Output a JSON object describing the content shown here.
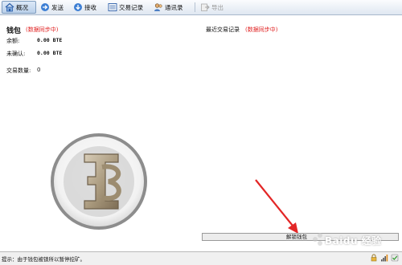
{
  "toolbar": {
    "items": [
      {
        "label": "概况",
        "icon": "home-icon",
        "active": true
      },
      {
        "label": "发送",
        "icon": "send-arrow-icon"
      },
      {
        "label": "接收",
        "icon": "receive-arrow-icon"
      },
      {
        "label": "交易记录",
        "icon": "transactions-list-icon"
      },
      {
        "label": "通讯录",
        "icon": "address-book-icon"
      },
      {
        "label": "导出",
        "icon": "export-icon",
        "disabled": true
      }
    ]
  },
  "wallet": {
    "title": "钱包",
    "sync_status": "(数据同步中)",
    "balance_label": "余额:",
    "balance_value": "0.00 BTE",
    "unconfirmed_label": "未确认:",
    "unconfirmed_value": "0.00 BTE",
    "tx_count_label": "交易数量:",
    "tx_count_value": "0"
  },
  "recent": {
    "title": "最近交易记录",
    "sync_status": "(数据同步中)"
  },
  "unlock_bar": {
    "label": "解锁钱包"
  },
  "status_bar": {
    "message": "提示：由于钱包被锁所以暂停挖矿。",
    "icons": [
      "lock-icon",
      "signal-bars-icon",
      "sync-check-icon"
    ]
  },
  "watermark": {
    "text": "Baidu 经验"
  },
  "colors": {
    "sync_red": "#e02020",
    "toolbar_top": "#fbfcfe",
    "toolbar_bottom": "#dfe7f1",
    "active_tab": "#b9cfe9"
  }
}
